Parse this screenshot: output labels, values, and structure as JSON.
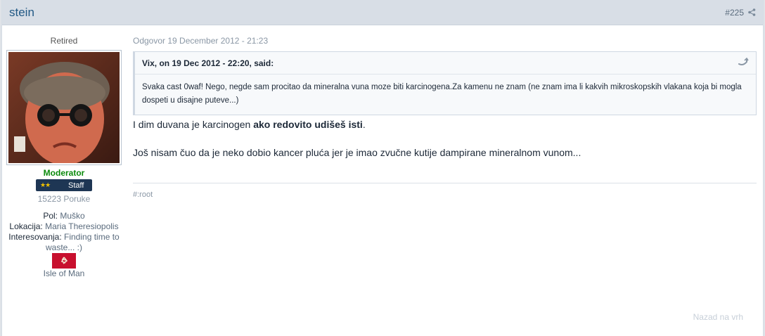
{
  "post": {
    "author": "stein",
    "number": "#225",
    "date": "Odgovor 19 December 2012 - 21:23"
  },
  "author_panel": {
    "rank_title": "Retired",
    "group": "Moderator",
    "badge_stars": "★★",
    "badge_label": "Staff",
    "post_count": "15223 Poruke",
    "fields": [
      {
        "label": "Pol:",
        "value": "Muško"
      },
      {
        "label": "Lokacija:",
        "value": "Maria Theresiopolis"
      },
      {
        "label": "Interesovanja:",
        "value": "Finding time to waste... :)"
      }
    ],
    "country": "Isle of Man"
  },
  "quote": {
    "citation": "Vix, on 19 Dec 2012 - 22:20, said:",
    "text": "Svaka cast 0waf! Nego, negde sam procitao da mineralna vuna moze biti karcinogena.Za kamenu ne znam (ne znam ima li kakvih mikroskopskih vlakana koja bi mogla dospeti u disajne puteve...)"
  },
  "body": {
    "line1_start": "I dim duvana je karcinogen ",
    "line1_bold": "ako redovito udišeš isti",
    "line1_end": ".",
    "line2": "Još nisam čuo da je neko dobio kancer pluća jer je imao zvučne kutije dampirane mineralnom vunom..."
  },
  "signature": "#:root",
  "back_to_top": "Nazad na vrh",
  "colors": {
    "header_bg": "#d8dee6",
    "author_link": "#225985",
    "moderator_green": "#0a8a0a",
    "badge_bg": "#1e3654"
  }
}
